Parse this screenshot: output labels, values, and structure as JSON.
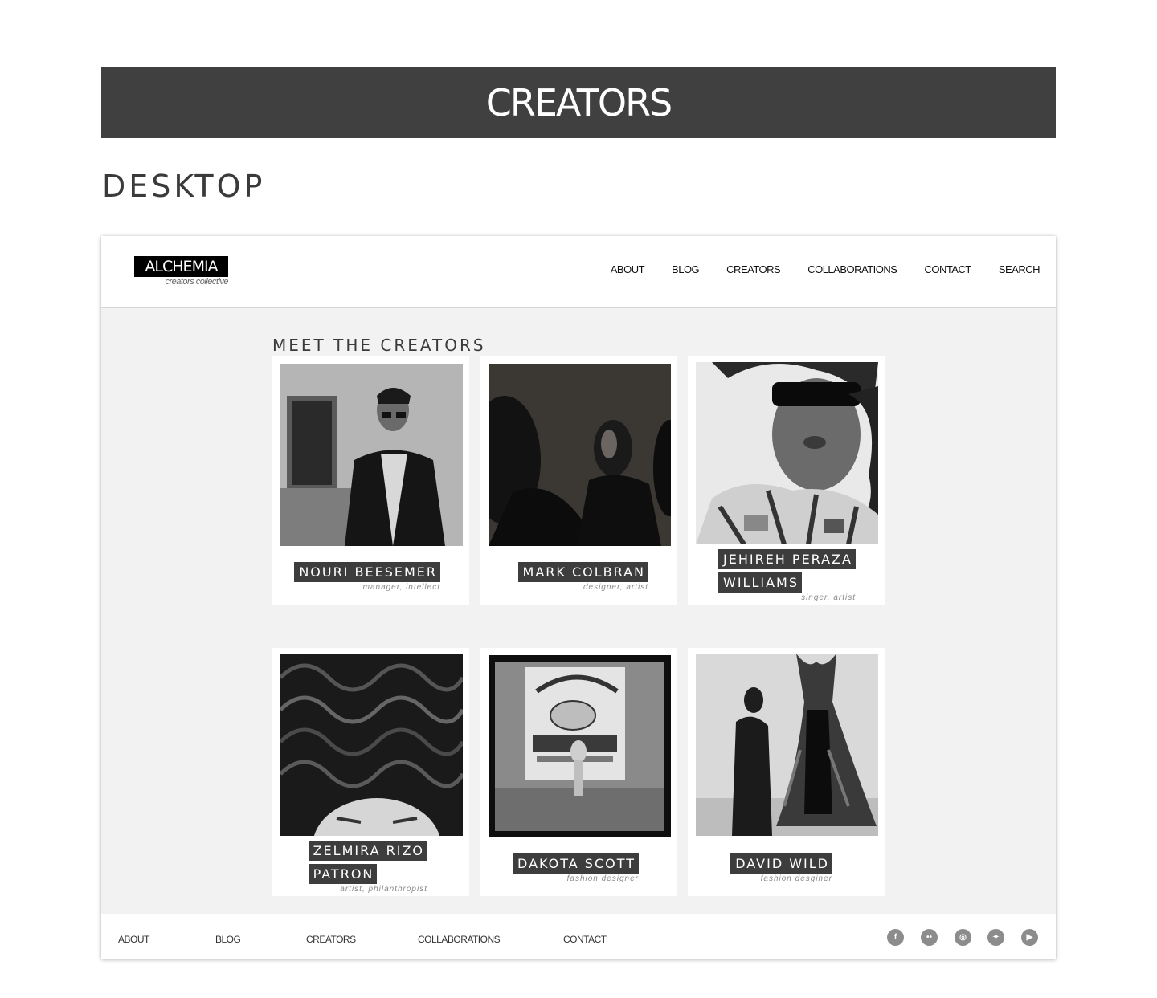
{
  "banner": {
    "title": "CREATORS"
  },
  "section": {
    "label": "DESKTOP"
  },
  "site": {
    "logo": {
      "name": "ALCHEMIA",
      "tagline": "creators collective"
    },
    "nav": [
      "ABOUT",
      "BLOG",
      "CREATORS",
      "COLLABORATIONS",
      "CONTACT",
      "SEARCH"
    ],
    "heading": "MEET THE CREATORS",
    "creators": [
      {
        "name_lines": [
          "NOURI BEESEMER"
        ],
        "role": "manager, intellect",
        "photo": "photo-man-leather-jacket"
      },
      {
        "name_lines": [
          "MARK COLBRAN"
        ],
        "role": "designer, artist",
        "photo": "photo-dark-silhouettes"
      },
      {
        "name_lines": [
          "JEHIREH PERAZA",
          "WILLIAMS"
        ],
        "role": "singer, artist",
        "photo": "photo-woman-sunglasses"
      },
      {
        "name_lines": [
          "ZELMIRA RIZO",
          "PATRON"
        ],
        "role": "artist, philanthropist",
        "photo": "photo-curly-hair"
      },
      {
        "name_lines": [
          "DAKOTA SCOTT"
        ],
        "role": "fashion designer",
        "photo": "photo-key-lime-pie-mural"
      },
      {
        "name_lines": [
          "DAVID WILD"
        ],
        "role": "fashion desginer",
        "photo": "photo-man-with-dress"
      }
    ],
    "footer": {
      "links": [
        "ABOUT",
        "BLOG",
        "CREATORS",
        "COLLABORATIONS",
        "CONTACT"
      ],
      "social": [
        {
          "icon": "facebook-icon",
          "glyph": "f"
        },
        {
          "icon": "flickr-icon",
          "glyph": "••"
        },
        {
          "icon": "instagram-icon",
          "glyph": "◎"
        },
        {
          "icon": "twitter-icon",
          "glyph": "✦"
        },
        {
          "icon": "youtube-icon",
          "glyph": "▶"
        }
      ]
    }
  },
  "colors": {
    "banner": "#404040",
    "frame_bg": "#f2f2f2",
    "name_tag": "#3d3d3d"
  }
}
